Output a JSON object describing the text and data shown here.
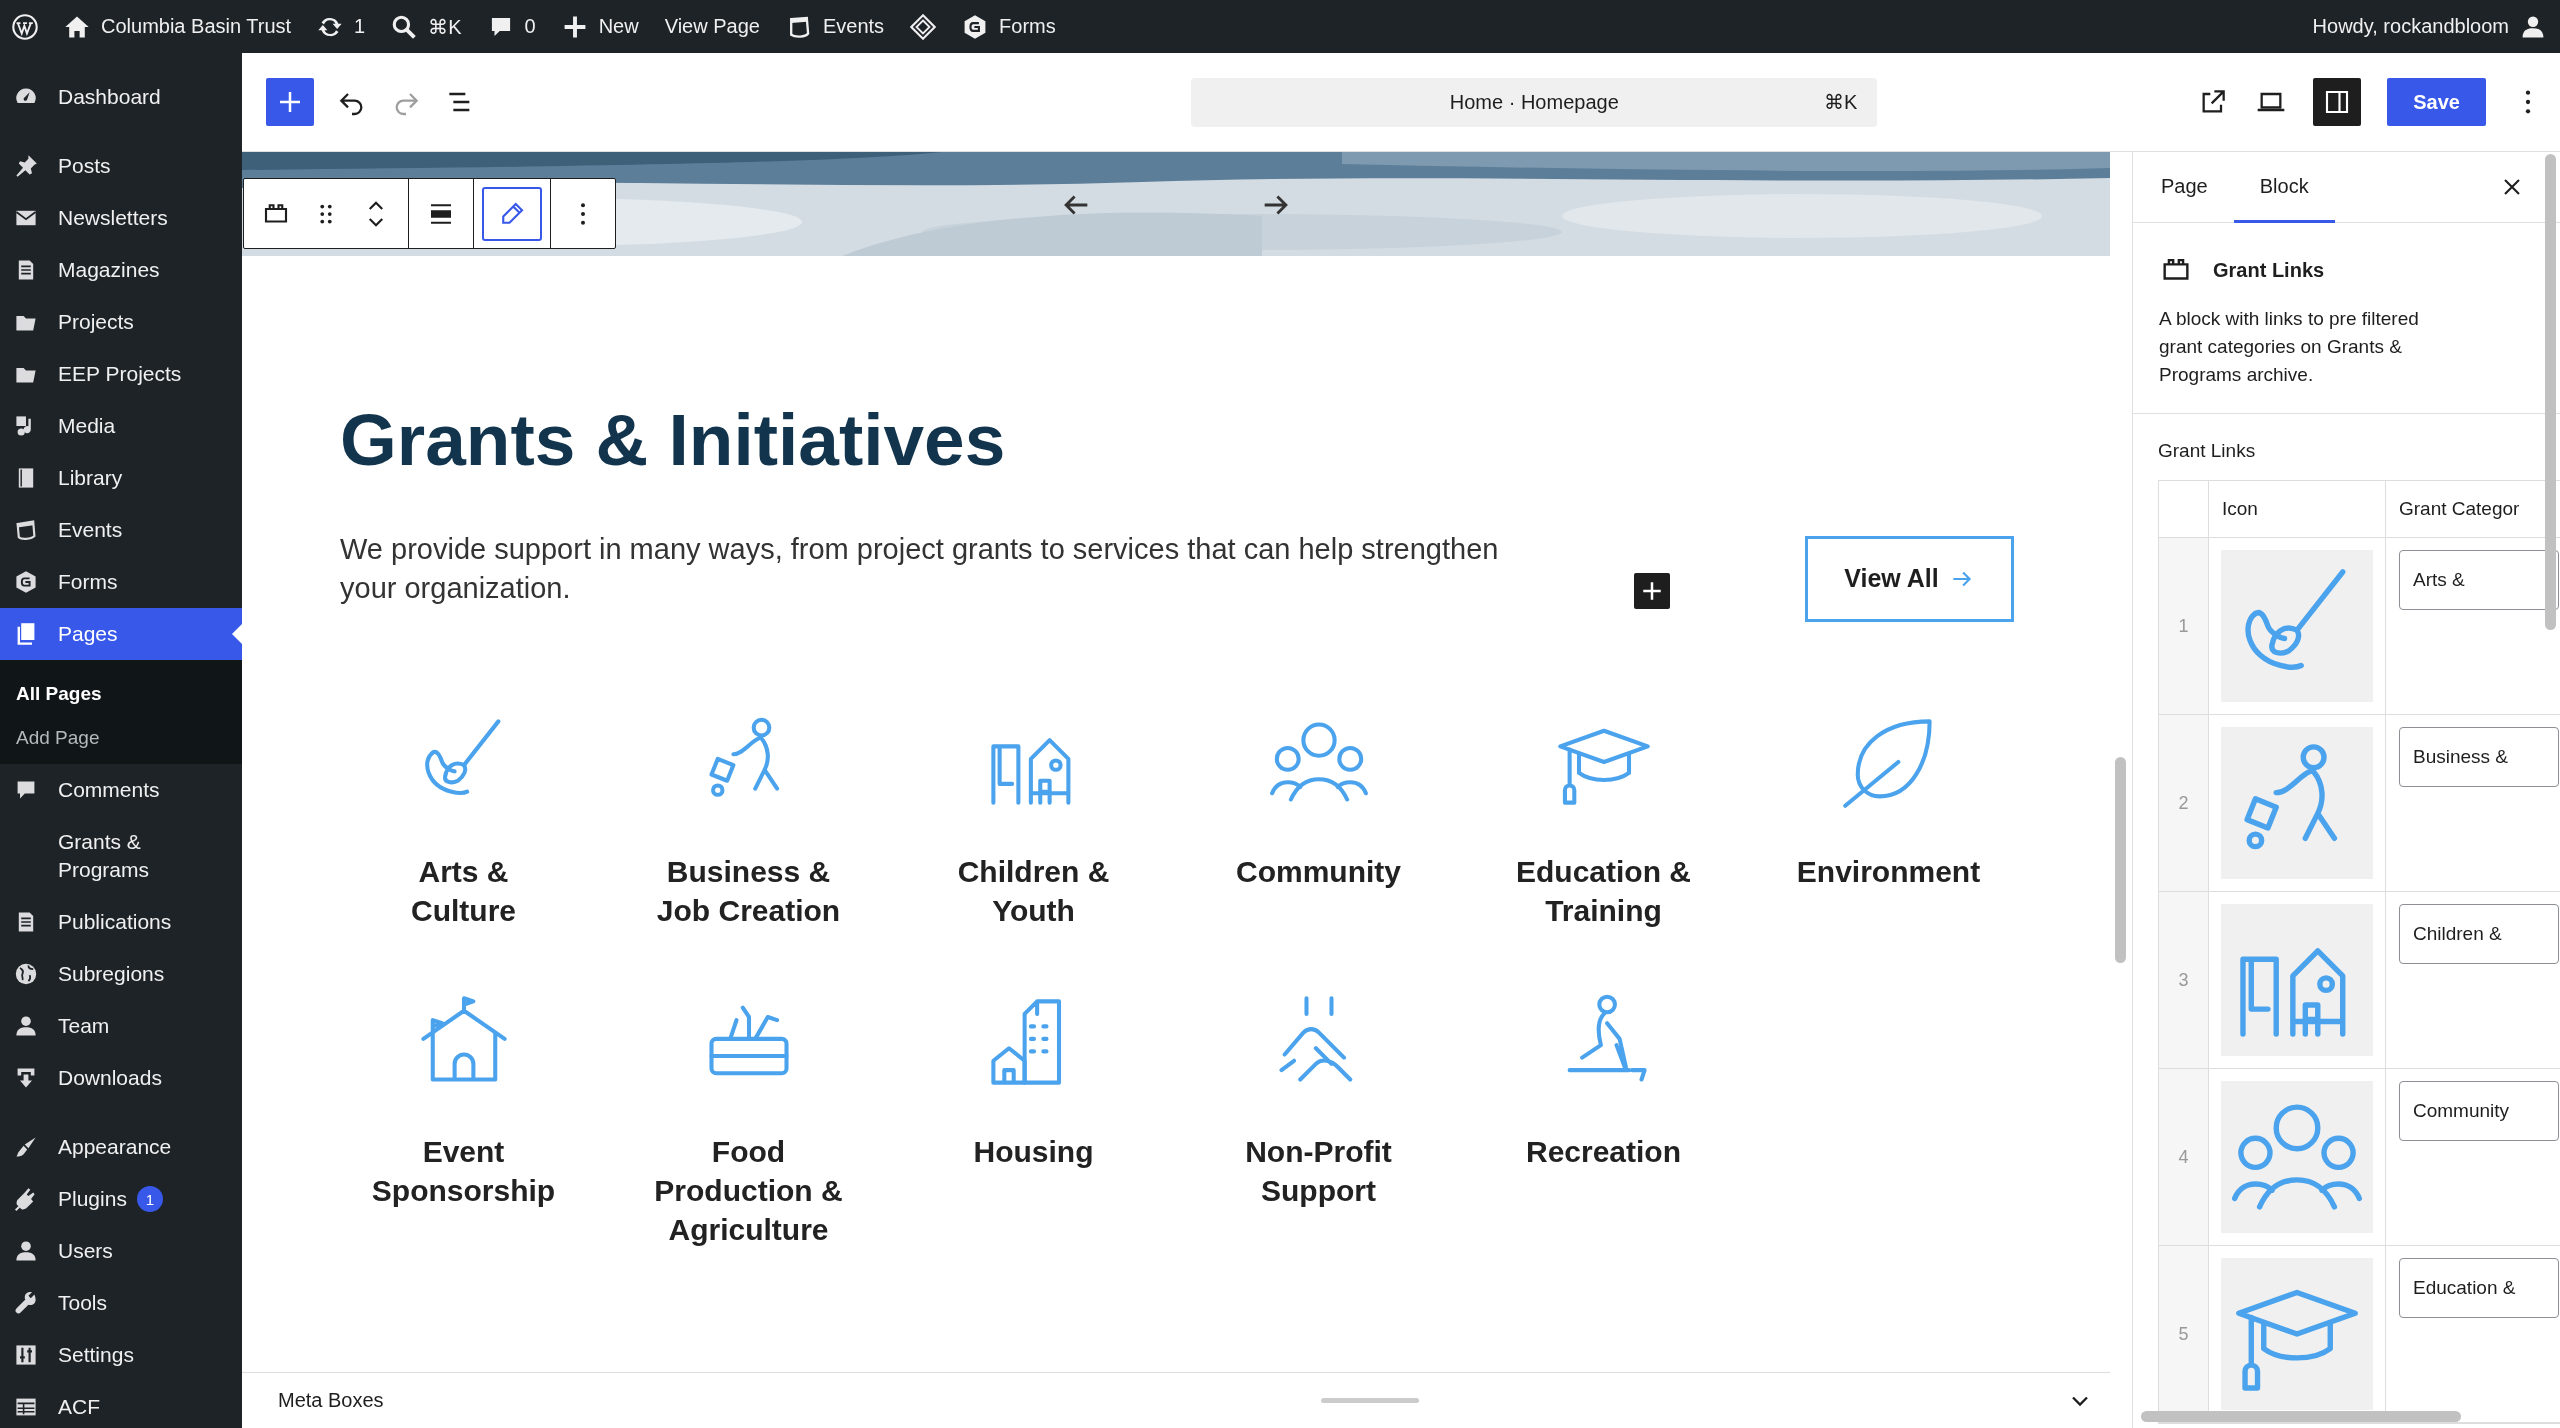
{
  "admin_bar": {
    "site": "Columbia Basin Trust",
    "updates": "1",
    "search": "⌘K",
    "comments": "0",
    "new": "New",
    "view": "View Page",
    "events": "Events",
    "forms": "Forms",
    "greeting": "Howdy, rockandbloom"
  },
  "sidebar": {
    "groups": [
      {
        "items": [
          {
            "label": "Dashboard",
            "selected": false
          }
        ]
      },
      {
        "items": [
          {
            "label": "Posts",
            "selected": false
          },
          {
            "label": "Newsletters",
            "selected": false
          },
          {
            "label": "Magazines",
            "selected": false
          },
          {
            "label": "Projects",
            "selected": false
          },
          {
            "label": "EEP Projects",
            "selected": false
          },
          {
            "label": "Media",
            "selected": false
          },
          {
            "label": "Library",
            "selected": false
          },
          {
            "label": "Events",
            "selected": false
          },
          {
            "label": "Forms",
            "selected": false
          },
          {
            "label": "Pages",
            "selected": true,
            "children": [
              {
                "label": "All Pages",
                "selected": true
              },
              {
                "label": "Add Page",
                "selected": false
              }
            ]
          },
          {
            "label": "Comments",
            "selected": false
          },
          {
            "label": "Grants & Programs",
            "selected": false
          },
          {
            "label": "Publications",
            "selected": false
          },
          {
            "label": "Subregions",
            "selected": false
          },
          {
            "label": "Team",
            "selected": false
          },
          {
            "label": "Downloads",
            "selected": false
          }
        ]
      },
      {
        "items": [
          {
            "label": "Appearance",
            "selected": false
          },
          {
            "label": "Plugins",
            "selected": false,
            "badge": "1"
          },
          {
            "label": "Users",
            "selected": false
          },
          {
            "label": "Tools",
            "selected": false
          },
          {
            "label": "Settings",
            "selected": false
          },
          {
            "label": "ACF",
            "selected": false
          }
        ]
      }
    ]
  },
  "editor_header": {
    "undo": {
      "disabled": false
    },
    "redo": {
      "disabled": true
    },
    "command_bar": {
      "title": "Home · Homepage",
      "shortcut": "⌘K"
    },
    "sidebar_toggle": {
      "on": true
    },
    "save_button": "Save"
  },
  "block_toolbar": {
    "tools": [
      {
        "selected": false
      },
      {
        "selected": false
      },
      {
        "selected": false
      },
      {
        "selected": false
      },
      {
        "selected": true
      },
      {
        "selected": false
      }
    ]
  },
  "section": {
    "heading": "Grants & Initiatives",
    "intro": "We provide support in many ways, from project grants to services that can help strengthen your organization.",
    "view_all": "View All",
    "categories": [
      {
        "label": "Arts & Culture"
      },
      {
        "label": "Business & Job Creation"
      },
      {
        "label": "Children & Youth"
      },
      {
        "label": "Community"
      },
      {
        "label": "Education & Training"
      },
      {
        "label": "Environment"
      },
      {
        "label": "Event Sponsorship"
      },
      {
        "label": "Food Production & Agriculture"
      },
      {
        "label": "Housing"
      },
      {
        "label": "Non-Profit Support"
      },
      {
        "label": "Recreation"
      }
    ]
  },
  "meta_boxes": {
    "label": "Meta Boxes",
    "expanded": false
  },
  "inspector": {
    "tabs": [
      {
        "label": "Page",
        "selected": false
      },
      {
        "label": "Block",
        "selected": true
      }
    ],
    "block": {
      "title": "Grant Links",
      "description": "A block with links to pre filtered grant categories on Grants & Programs archive."
    },
    "field_label": "Grant Links",
    "table": {
      "columns": [
        "Icon",
        "Grant Categor"
      ],
      "rows": [
        {
          "number": "1",
          "value": "Arts &"
        },
        {
          "number": "2",
          "value": "Business &"
        },
        {
          "number": "3",
          "value": "Children &"
        },
        {
          "number": "4",
          "value": "Community"
        },
        {
          "number": "5",
          "value": "Education &"
        }
      ]
    }
  }
}
